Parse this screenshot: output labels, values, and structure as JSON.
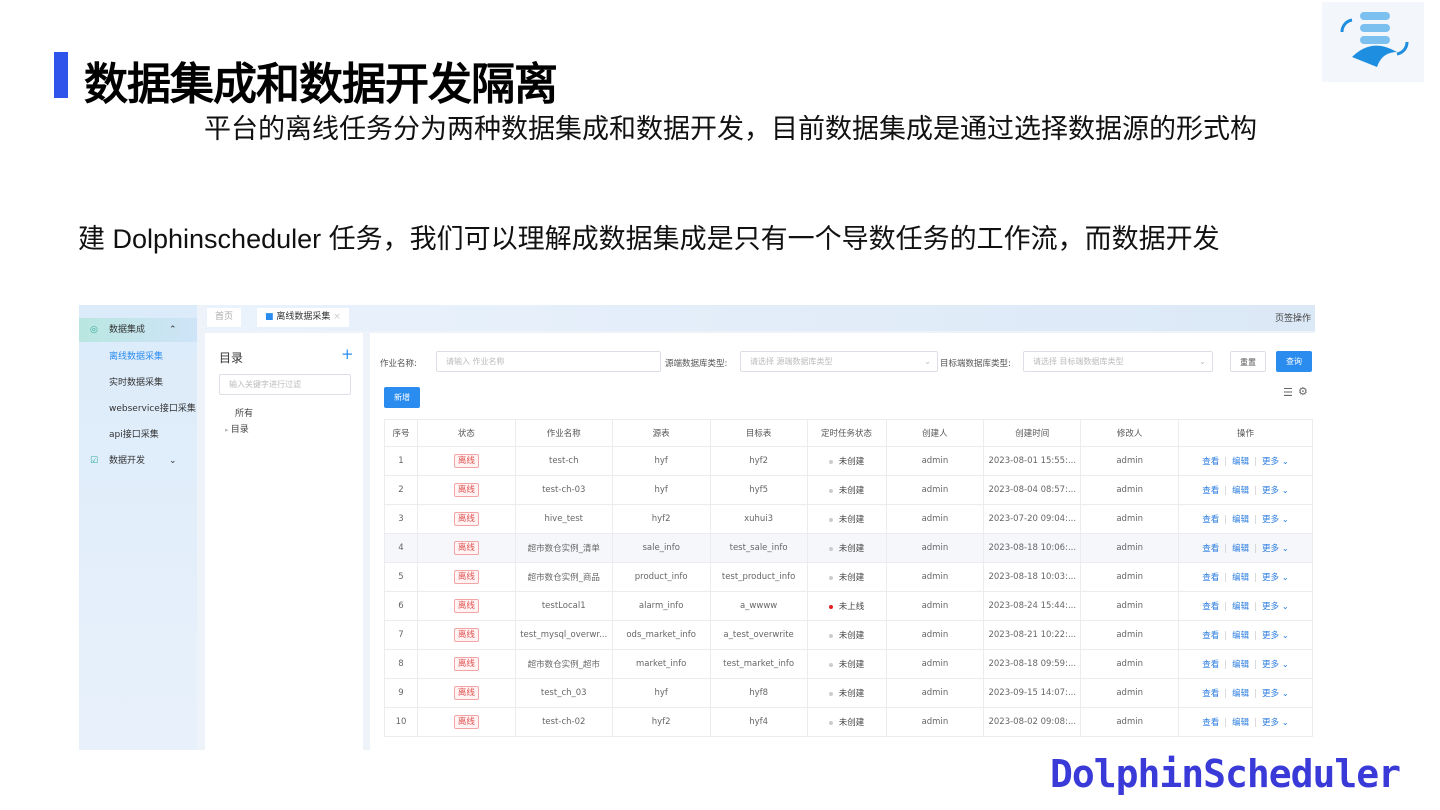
{
  "slide": {
    "title": "数据集成和数据开发隔离",
    "para1": "平台的离线任务分为两种数据集成和数据开发，目前数据集成是通过选择数据源的形式构",
    "para2": "建 Dolphinscheduler 任务，我们可以理解成数据集成是只有一个导数任务的工作流，而数据开发",
    "brand": "DolphinScheduler"
  },
  "colors": {
    "accent": "#2f54eb",
    "primary": "#2b8cf0",
    "offline": "#e05050"
  },
  "sidebar": {
    "group1": "数据集成",
    "items": [
      "离线数据采集",
      "实时数据采集",
      "webservice接口采集",
      "api接口采集"
    ],
    "group2": "数据开发"
  },
  "tabs": {
    "home": "首页",
    "current": "离线数据采集",
    "page_ops": "页签操作"
  },
  "dir": {
    "title": "目录",
    "filter_placeholder": "输入关键字进行过滤",
    "all": "所有",
    "node": "目录"
  },
  "filters": {
    "job_label": "作业名称:",
    "job_placeholder": "请输入 作业名称",
    "src_label": "源端数据库类型:",
    "src_placeholder": "请选择 源端数据库类型",
    "dst_label": "目标端数据库类型:",
    "dst_placeholder": "请选择 目标端数据库类型",
    "reset": "重置",
    "query": "查询",
    "add": "新增"
  },
  "table": {
    "headers": [
      "序号",
      "状态",
      "作业名称",
      "源表",
      "目标表",
      "定时任务状态",
      "创建人",
      "创建时间",
      "修改人",
      "操作"
    ],
    "actions": [
      "查看",
      "编辑",
      "更多"
    ],
    "rows": [
      [
        "1",
        "离线",
        "test-ch",
        "hyf",
        "hyf2",
        "未创建",
        "admin",
        "2023-08-01 15:55:...",
        "admin"
      ],
      [
        "2",
        "离线",
        "test-ch-03",
        "hyf",
        "hyf5",
        "未创建",
        "admin",
        "2023-08-04 08:57:...",
        "admin"
      ],
      [
        "3",
        "离线",
        "hive_test",
        "hyf2",
        "xuhui3",
        "未创建",
        "admin",
        "2023-07-20 09:04:...",
        "admin"
      ],
      [
        "4",
        "离线",
        "超市数仓实例_清单",
        "sale_info",
        "test_sale_info",
        "未创建",
        "admin",
        "2023-08-18 10:06:...",
        "admin"
      ],
      [
        "5",
        "离线",
        "超市数仓实例_商品",
        "product_info",
        "test_product_info",
        "未创建",
        "admin",
        "2023-08-18 10:03:...",
        "admin"
      ],
      [
        "6",
        "离线",
        "testLocal1",
        "alarm_info",
        "a_wwww",
        "未上线",
        "admin",
        "2023-08-24 15:44:...",
        "admin"
      ],
      [
        "7",
        "离线",
        "test_mysql_overwr...",
        "ods_market_info",
        "a_test_overwrite",
        "未创建",
        "admin",
        "2023-08-21 10:22:...",
        "admin"
      ],
      [
        "8",
        "离线",
        "超市数仓实例_超市",
        "market_info",
        "test_market_info",
        "未创建",
        "admin",
        "2023-08-18 09:59:...",
        "admin"
      ],
      [
        "9",
        "离线",
        "test_ch_03",
        "hyf",
        "hyf8",
        "未创建",
        "admin",
        "2023-09-15 14:07:...",
        "admin"
      ],
      [
        "10",
        "离线",
        "test-ch-02",
        "hyf2",
        "hyf4",
        "未创建",
        "admin",
        "2023-08-02 09:08:...",
        "admin"
      ]
    ]
  }
}
